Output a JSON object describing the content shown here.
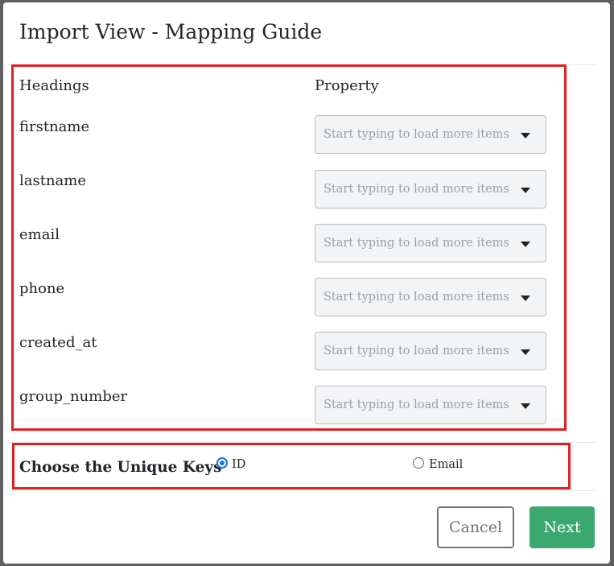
{
  "modal": {
    "title": "Import View - Mapping Guide"
  },
  "mapping": {
    "headings_label": "Headings",
    "property_label": "Property",
    "rows": [
      {
        "heading": "firstname",
        "placeholder": "Start typing to load more items"
      },
      {
        "heading": "lastname",
        "placeholder": "Start typing to load more items"
      },
      {
        "heading": "email",
        "placeholder": "Start typing to load more items"
      },
      {
        "heading": "phone",
        "placeholder": "Start typing to load more items"
      },
      {
        "heading": "created_at",
        "placeholder": "Start typing to load more items"
      },
      {
        "heading": "group_number",
        "placeholder": "Start typing to load more items"
      }
    ]
  },
  "unique_keys": {
    "label": "Choose the Unique Keys",
    "options": [
      {
        "label": "ID",
        "checked": true
      },
      {
        "label": "Email",
        "checked": false
      }
    ]
  },
  "footer": {
    "cancel_label": "Cancel",
    "next_label": "Next"
  },
  "colors": {
    "highlight": "#e02020",
    "next_button": "#3aa86f",
    "radio_checked": "#1a73e8"
  },
  "icons": {
    "select_caret": "caret-down-icon"
  }
}
